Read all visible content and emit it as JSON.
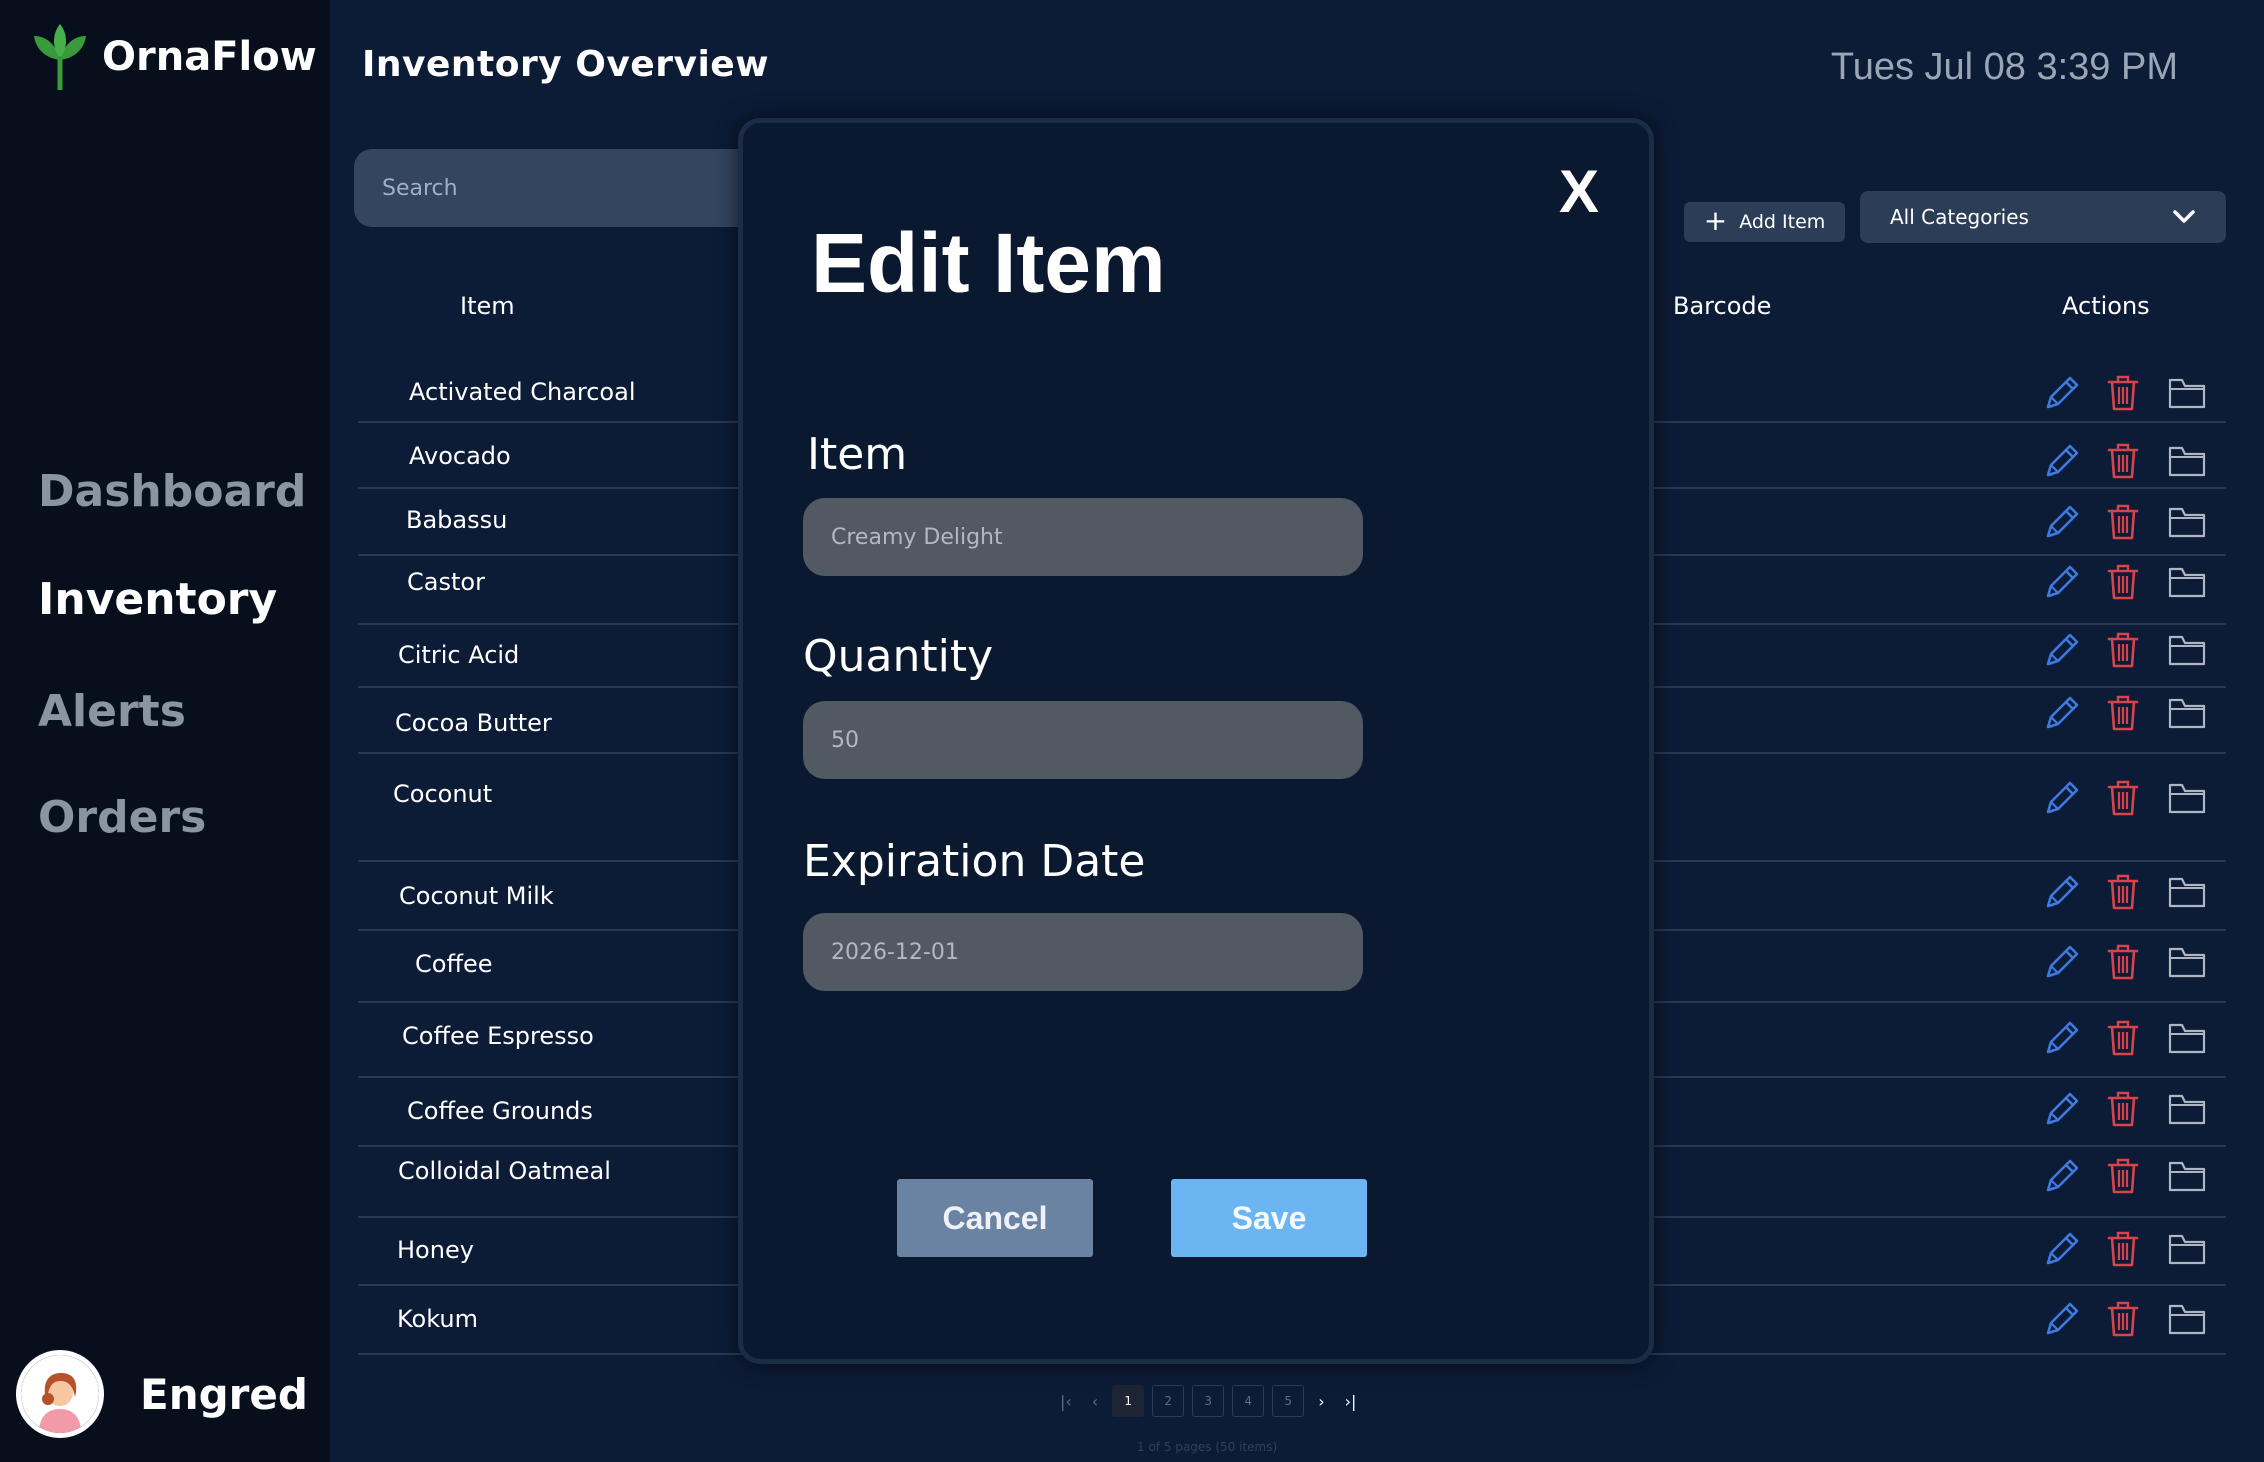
{
  "app": {
    "name": "OrnaFlow"
  },
  "sidebar": {
    "items": [
      {
        "label": "Dashboard",
        "active": false
      },
      {
        "label": "Inventory",
        "active": true
      },
      {
        "label": "Alerts",
        "active": false
      },
      {
        "label": "Orders",
        "active": false
      }
    ],
    "user": {
      "name": "Engred"
    }
  },
  "header": {
    "title": "Inventory Overview",
    "datetime": "Tues Jul 08 3:39 PM"
  },
  "toolbar": {
    "search_placeholder": "Search",
    "add_label": "Add Item",
    "category_selected": "All Categories"
  },
  "table": {
    "columns": {
      "item": "Item",
      "barcode": "Barcode",
      "actions": "Actions"
    },
    "rows": [
      "Activated Charcoal",
      "Avocado",
      "Babassu",
      "Castor",
      "Citric Acid",
      "Cocoa Butter",
      "Coconut",
      "Coconut Milk",
      "Coffee",
      "Coffee Espresso",
      "Coffee Grounds",
      "Colloidal Oatmeal",
      "Honey",
      "Kokum"
    ]
  },
  "pagination": {
    "pages": [
      "1",
      "2",
      "3",
      "4",
      "5"
    ],
    "current": "1",
    "info": "1 of 5 pages (50 items)",
    "first_icon": "first-page-icon",
    "prev_icon": "prev-page-icon",
    "next_icon": "next-page-icon",
    "last_icon": "last-page-icon"
  },
  "modal": {
    "title": "Edit Item",
    "close_label": "X",
    "fields": {
      "item": {
        "label": "Item",
        "value": "Creamy Delight"
      },
      "quantity": {
        "label": "Quantity",
        "value": "50"
      },
      "expiration": {
        "label": "Expiration Date",
        "value": "2026-12-01"
      }
    },
    "cancel_label": "Cancel",
    "save_label": "Save"
  },
  "colors": {
    "background": "#0c1b36",
    "sidebar": "#070f1d",
    "edit_icon": "#3f7ae0",
    "delete_icon": "#d9434b",
    "folder_icon": "#aeb6c2",
    "save": "#6bb5f3",
    "cancel": "#6b83a2",
    "brand_leaf": "#3a9b3c"
  }
}
